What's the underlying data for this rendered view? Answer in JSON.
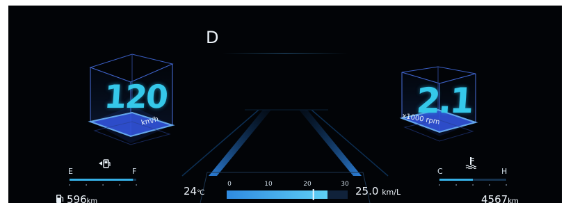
{
  "gear": "D",
  "speed": {
    "value": "120",
    "unit": "km/h"
  },
  "rpm": {
    "value": "2.1",
    "unit": "x1000 rpm"
  },
  "fuel_gauge": {
    "empty_label": "E",
    "full_label": "F",
    "level": 0.95,
    "icon": "fuel-pump-icon"
  },
  "temp_gauge": {
    "cold_label": "C",
    "hot_label": "H",
    "level": 0.5,
    "icon": "coolant-temperature-icon"
  },
  "outside_temp": {
    "value": "24",
    "unit": "℃"
  },
  "fuel_economy": {
    "value": "25.0",
    "unit": "km/L",
    "ticks": [
      "0",
      "10",
      "20",
      "30"
    ],
    "current": 25.0,
    "average": 21.5,
    "max": 30
  },
  "range": {
    "value": "596",
    "unit": "km",
    "icon": "fuel-pump-icon"
  },
  "odometer": {
    "value": "4567",
    "unit": "km"
  },
  "colors": {
    "accent": "#35c8ea",
    "box": "#4a6fe0",
    "background": "#020407"
  }
}
